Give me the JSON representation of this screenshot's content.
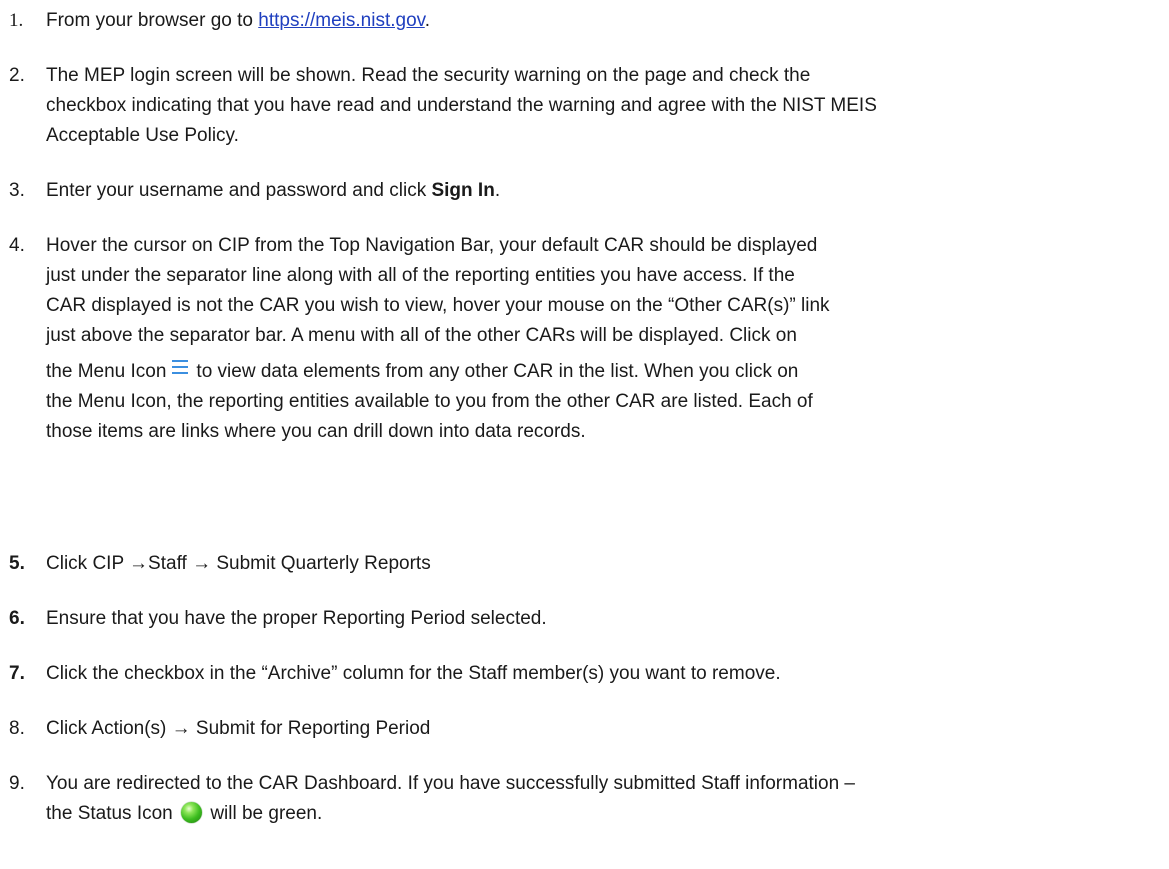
{
  "steps": [
    {
      "num": "1.",
      "pre": "From your browser go to ",
      "link": "https://meis.nist.gov",
      "post": "."
    },
    {
      "num": "2.",
      "lines": [
        "The MEP login screen will be shown. Read the security warning on the page and check the",
        "checkbox indicating that you have read and understand the warning and agree with the NIST MEIS",
        "Acceptable Use Policy."
      ]
    },
    {
      "num": "3.",
      "pre": "Enter your username and password and click ",
      "bold": "Sign In",
      "post": "."
    },
    {
      "num": "4.",
      "lines": [
        "Hover the cursor on CIP from the Top Navigation Bar, your default CAR should be displayed",
        "just under the separator line along with all of the reporting entities you have access. If the",
        "CAR displayed is not the CAR you wish to view, hover your mouse on the “Other CAR(s)” link",
        "just above the separator bar.  A menu with all of the other CARs will be displayed.  Click on"
      ],
      "icon_pre": "the Menu Icon",
      "icon_post": "to view data elements from any other CAR in the list.  When you click on",
      "lines_after": [
        "the Menu Icon, the reporting entities available to you from the other CAR are listed.  Each of",
        "those items are links where you can drill down into data records."
      ]
    },
    {
      "num": "5.",
      "text": "Click CIP →Staff → Submit Quarterly Reports"
    },
    {
      "num": "6.",
      "text": "Ensure that you have the proper Reporting Period selected."
    },
    {
      "num": "7.",
      "text": "Click the checkbox in the “Archive” column for the Staff member(s) you want to remove."
    },
    {
      "num": "8.",
      "text": "Click Action(s) → Submit for Reporting Period"
    },
    {
      "num": "9.",
      "line1": "You are redirected to the CAR Dashboard. If you have successfully submitted Staff information –",
      "icon_pre": "the Status Icon",
      "icon_post": "will be green."
    }
  ],
  "icons": {
    "menu": "menu-icon",
    "status": "status-icon-green"
  },
  "colors": {
    "link": "#1f3fbf",
    "menu_icon": "#3b8fe0",
    "status_icon": "#3cbd1f"
  }
}
